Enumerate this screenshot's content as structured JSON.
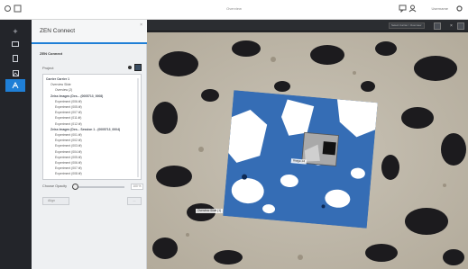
{
  "titlebar": {
    "title": "Overview",
    "user": "Username"
  },
  "rail": {
    "items": [
      "add",
      "dashboard",
      "documents",
      "images",
      "zen-connect"
    ]
  },
  "panel": {
    "title": "ZEN Connect",
    "section": "ZEN Connect",
    "project_label": "Project",
    "tree": [
      {
        "text": "Carrier Carrier 1",
        "level": 0,
        "hdr": true
      },
      {
        "text": "Overview Slide",
        "level": 1,
        "hdr": false
      },
      {
        "text": "Overview (2)",
        "level": 2,
        "hdr": false
      },
      {
        "text": "Zeiss Images (Des... (0005713_0008)",
        "level": 1,
        "hdr": true
      },
      {
        "text": "Experiment (006.tif)",
        "level": 2,
        "hdr": false
      },
      {
        "text": "Experiment (005.tif)",
        "level": 2,
        "hdr": false
      },
      {
        "text": "Experiment (007.tif)",
        "level": 2,
        "hdr": false
      },
      {
        "text": "Experiment (011.tif)",
        "level": 2,
        "hdr": false
      },
      {
        "text": "Experiment (012.tif)",
        "level": 2,
        "hdr": false
      },
      {
        "text": "Zeiss Images (Des... Session 1 - (0005713_0004)",
        "level": 1,
        "hdr": true
      },
      {
        "text": "Experiment (001.tif)",
        "level": 2,
        "hdr": false
      },
      {
        "text": "Experiment (002.tif)",
        "level": 2,
        "hdr": false
      },
      {
        "text": "Experiment (003.tif)",
        "level": 2,
        "hdr": false
      },
      {
        "text": "Experiment (004.tif)",
        "level": 2,
        "hdr": false
      },
      {
        "text": "Experiment (005.tif)",
        "level": 2,
        "hdr": false
      },
      {
        "text": "Experiment (006.tif)",
        "level": 2,
        "hdr": false
      },
      {
        "text": "Experiment (007.tif)",
        "level": 2,
        "hdr": false
      },
      {
        "text": "Experiment (008.tif)",
        "level": 2,
        "hdr": false
      }
    ],
    "choose_label": "Choose Opacity",
    "slider_value": "100 %",
    "slider_level": 0.05,
    "align_label": "Align",
    "small_button_label": "..."
  },
  "viewer": {
    "select_value": "Select Carrier / Overview",
    "image_label": "Image #4",
    "scale_label": "Overview Slide (1)"
  },
  "colors": {
    "accent": "#1f7fd6",
    "rail": "#23252a",
    "panel": "#eef0f2"
  }
}
